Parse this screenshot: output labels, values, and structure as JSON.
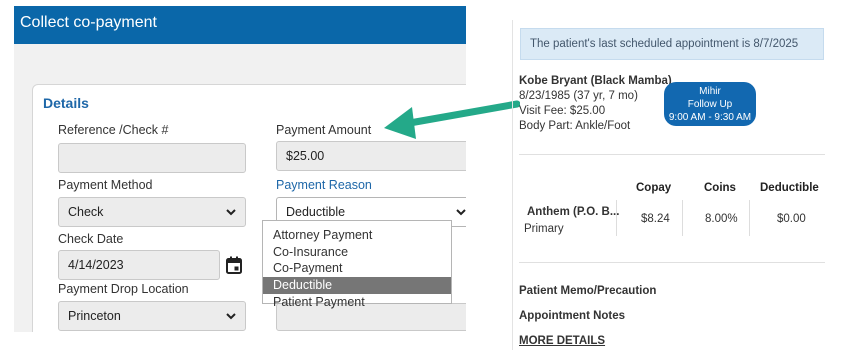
{
  "modal": {
    "title": "Collect co-payment",
    "details_title": "Details",
    "reference_label": "Reference /Check #",
    "reference_value": "",
    "payment_amount_label": "Payment Amount",
    "payment_amount_value": "$25.00",
    "payment_method_label": "Payment Method",
    "payment_method_value": "Check",
    "payment_reason_label": "Payment Reason",
    "payment_reason_value": "Deductible",
    "payment_reason_options": [
      "Attorney Payment",
      "Co-Insurance",
      "Co-Payment",
      "Deductible",
      "Patient Payment"
    ],
    "payment_reason_selected_index": 3,
    "check_date_label": "Check Date",
    "check_date_value": "4/14/2023",
    "drop_location_label": "Payment Drop Location",
    "drop_location_value": "Princeton"
  },
  "right": {
    "banner": "The patient's last scheduled appointment is 8/7/2025",
    "patient_name": "Kobe Bryant (Black Mamba)",
    "patient_dob": "8/23/1985 (37 yr, 7 mo)",
    "visit_fee": "Visit Fee: $25.00",
    "body_part": "Body Part: Ankle/Foot",
    "appointment_pill": {
      "line1": "Mihir",
      "line2": "Follow Up",
      "line3": "9:00 AM - 9:30 AM"
    },
    "insurance": {
      "headers": [
        "Copay",
        "Coins",
        "Deductible"
      ],
      "plan_name": "Anthem (P.O. B...",
      "plan_type": "Primary",
      "copay": "$8.24",
      "coins": "8.00%",
      "deductible": "$0.00"
    },
    "patient_memo": "Patient Memo/Precaution",
    "appointment_notes": "Appointment Notes",
    "more_details": "MORE DETAILS"
  },
  "colors": {
    "header_blue": "#0a67a9",
    "accent_blue": "#1e67a8",
    "arrow_green": "#24a989",
    "banner_bg": "#dbeaf6"
  }
}
